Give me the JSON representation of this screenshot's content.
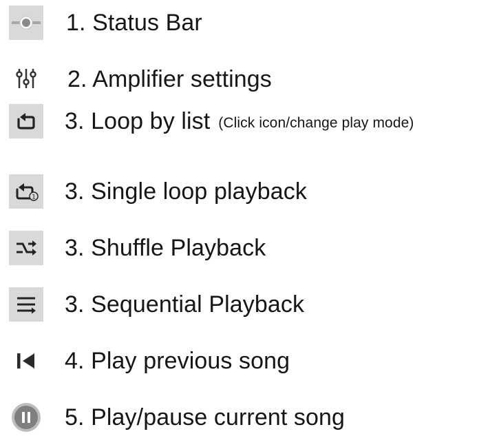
{
  "colors": {
    "icon_background": "#d9d9d9",
    "icon_foreground": "#333333",
    "status_knob": "#8a8a8a",
    "play_button": "#7f7f7f",
    "text": "#161616"
  },
  "items": [
    {
      "icon": "status-bar-slider-icon",
      "label": "1. Status Bar",
      "note": ""
    },
    {
      "icon": "equalizer-sliders-icon",
      "label": "2. Amplifier settings",
      "note": ""
    },
    {
      "icon": "loop-list-icon",
      "label": "3. Loop by list",
      "note": "(Click icon/change play mode)"
    },
    {
      "icon": "loop-single-icon",
      "label": "3. Single loop playback",
      "note": ""
    },
    {
      "icon": "shuffle-icon",
      "label": "3. Shuffle Playback",
      "note": ""
    },
    {
      "icon": "sequential-playback-icon",
      "label": "3. Sequential Playback",
      "note": ""
    },
    {
      "icon": "previous-track-icon",
      "label": "4. Play previous song",
      "note": ""
    },
    {
      "icon": "play-pause-icon",
      "label": "5. Play/pause current song",
      "note": ""
    }
  ]
}
